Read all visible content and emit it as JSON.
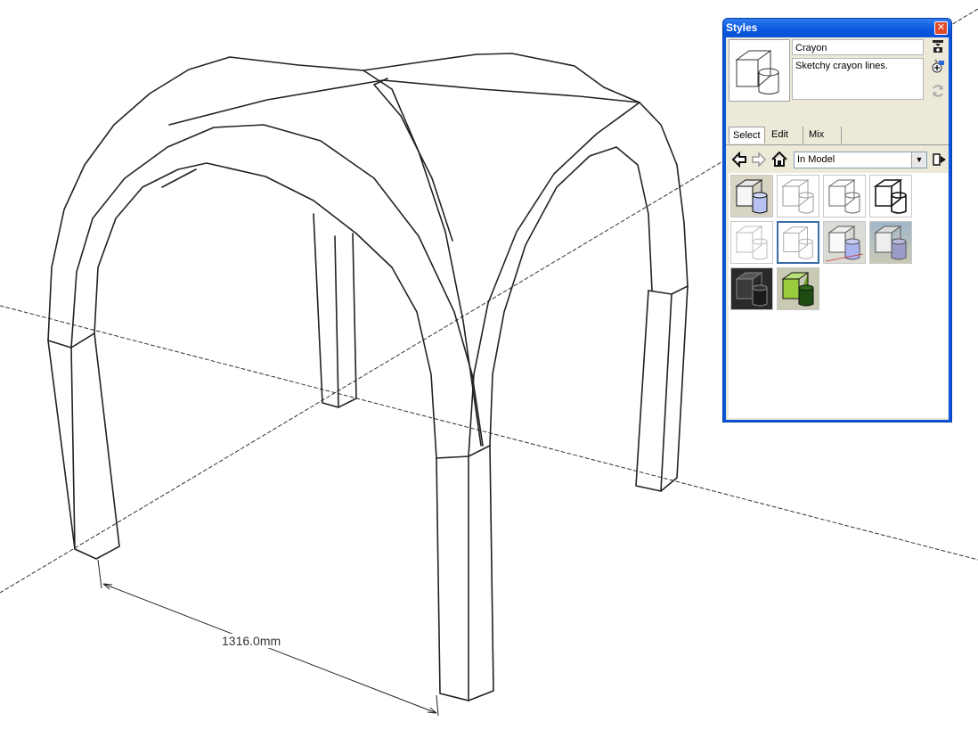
{
  "dimension": {
    "label": "1316.0mm"
  },
  "styles_panel": {
    "title": "Styles",
    "style_name": "Crayon",
    "style_description": "Sketchy crayon lines.",
    "tabs": [
      {
        "label": "Select",
        "selected": true
      },
      {
        "label": "Edit",
        "selected": false
      },
      {
        "label": "Mix",
        "selected": false
      }
    ],
    "collection": "In Model",
    "swatches": [
      "default-shaded-style",
      "sketchy-style-1",
      "sketchy-style-2",
      "sketchy-style-3",
      "light-sketch-style",
      "crayon-style",
      "shaded-blue-style",
      "shaded-sky-style",
      "dark-style",
      "green-style"
    ],
    "selected_swatch": 5,
    "accent": "#0a55dd"
  }
}
